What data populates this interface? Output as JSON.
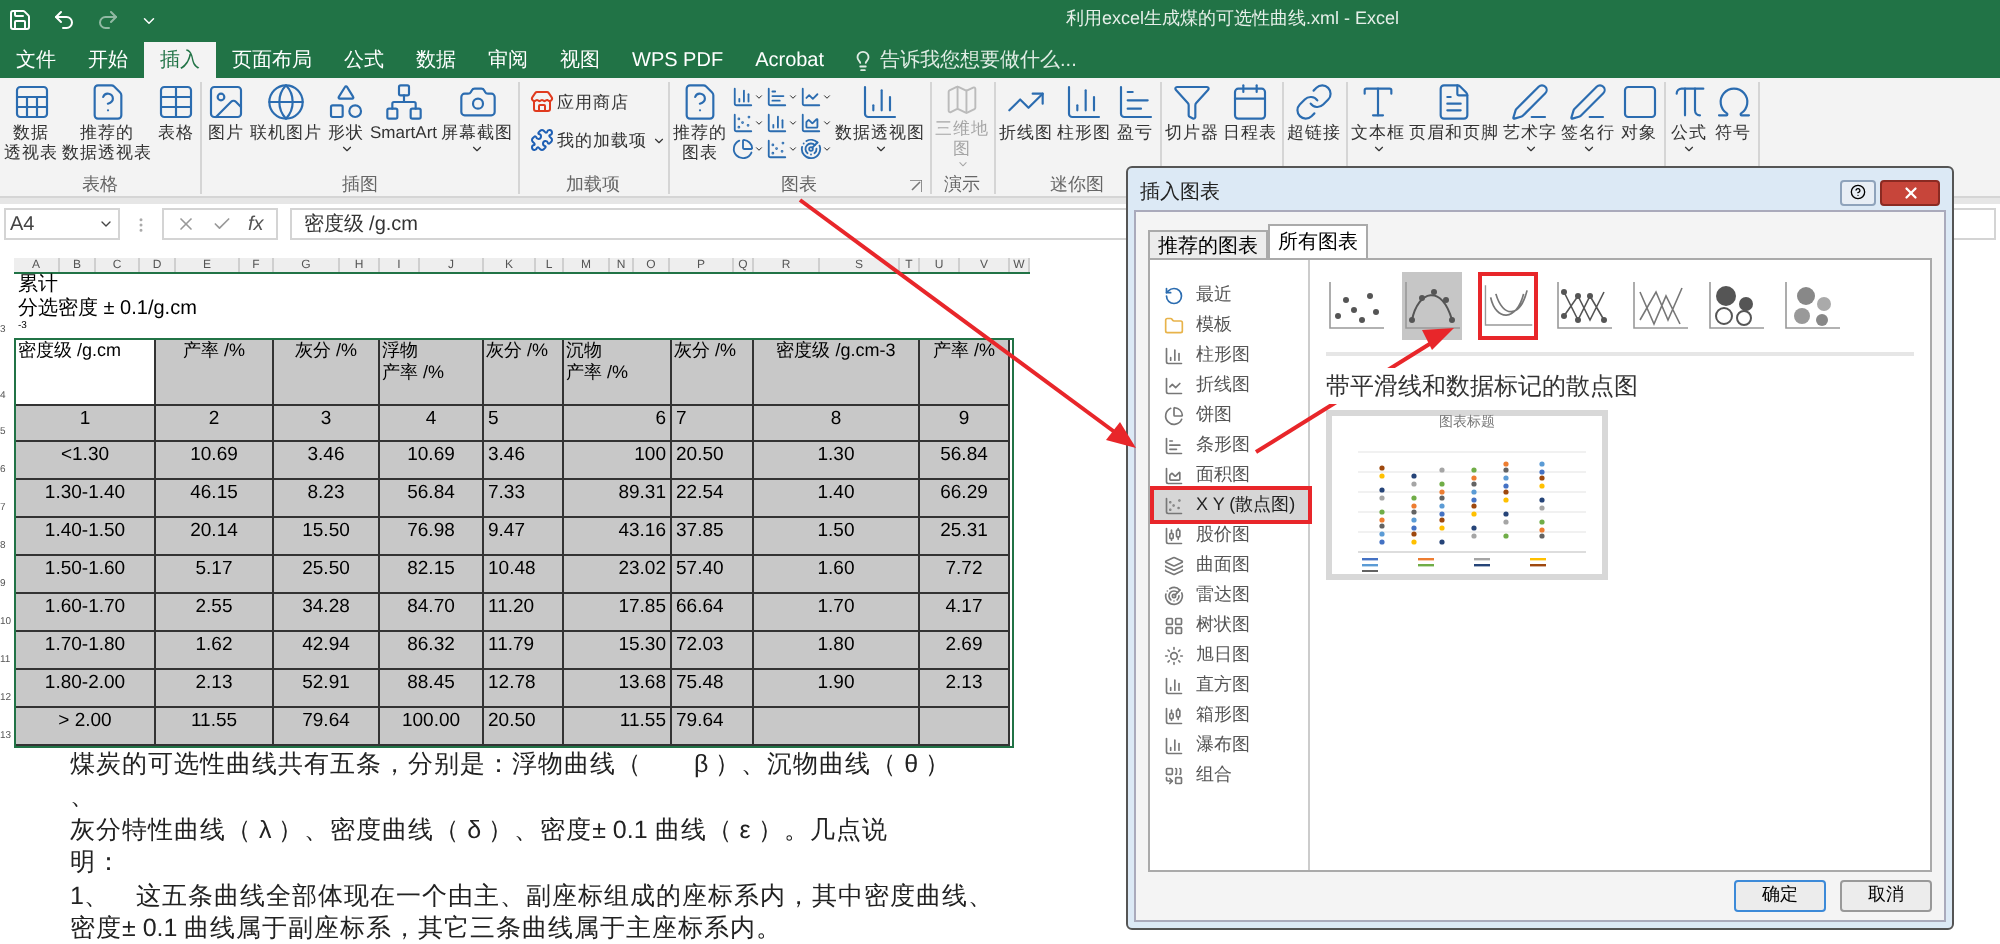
{
  "window": {
    "title": "利用excel生成煤的可选性曲线.xml - Excel"
  },
  "ribbon_tabs": [
    {
      "label": "文件",
      "selected": false
    },
    {
      "label": "开始",
      "selected": false
    },
    {
      "label": "插入",
      "selected": true
    },
    {
      "label": "页面布局",
      "selected": false
    },
    {
      "label": "公式",
      "selected": false
    },
    {
      "label": "数据",
      "selected": false
    },
    {
      "label": "审阅",
      "selected": false
    },
    {
      "label": "视图",
      "selected": false
    },
    {
      "label": "WPS PDF",
      "selected": false
    },
    {
      "label": "Acrobat",
      "selected": false
    }
  ],
  "tell_me": {
    "placeholder": "告诉我您想要做什么..."
  },
  "ribbon_groups": [
    {
      "label": "表格",
      "kind": "large",
      "buttons": [
        {
          "label": [
            "数据",
            "透视表"
          ],
          "dropdown": false,
          "disabled": false
        },
        {
          "label": [
            "推荐的",
            "数据透视表"
          ],
          "dropdown": false,
          "disabled": false
        },
        {
          "label": [
            "表格"
          ],
          "dropdown": false,
          "disabled": false
        }
      ]
    },
    {
      "label": "插图",
      "kind": "large",
      "buttons": [
        {
          "label": [
            "图片"
          ],
          "dropdown": false,
          "disabled": false
        },
        {
          "label": [
            "联机图片"
          ],
          "dropdown": false,
          "disabled": false
        },
        {
          "label": [
            "形状"
          ],
          "dropdown": true,
          "disabled": false
        },
        {
          "label": [
            "SmartArt"
          ],
          "dropdown": false,
          "disabled": false
        },
        {
          "label": [
            "屏幕截图"
          ],
          "dropdown": true,
          "disabled": false
        }
      ]
    },
    {
      "label": "加载项",
      "kind": "small",
      "buttons": [
        {
          "label": [
            "应用商店"
          ],
          "dropdown": false,
          "disabled": false
        },
        {
          "label": [
            "我的加载项"
          ],
          "dropdown": true,
          "disabled": false
        }
      ]
    },
    {
      "label": "图表",
      "kind": "chart",
      "buttons": [
        {
          "label": [
            "推荐的",
            "图表"
          ],
          "dropdown": false,
          "disabled": false
        },
        {
          "label": [
            "数据透视图"
          ],
          "dropdown": true,
          "disabled": false
        }
      ]
    },
    {
      "label": "演示",
      "kind": "large",
      "buttons": [
        {
          "label": [
            "三维地",
            "图"
          ],
          "dropdown": true,
          "disabled": true
        }
      ]
    },
    {
      "label": "迷你图",
      "kind": "large",
      "buttons": [
        {
          "label": [
            "折线图"
          ],
          "dropdown": false,
          "disabled": false
        },
        {
          "label": [
            "柱形图"
          ],
          "dropdown": false,
          "disabled": false
        },
        {
          "label": [
            "盈亏"
          ],
          "dropdown": false,
          "disabled": false
        }
      ]
    },
    {
      "kind": "large",
      "buttons": [
        {
          "label": [
            "切片器"
          ],
          "dropdown": false,
          "disabled": false
        },
        {
          "label": [
            "日程表"
          ],
          "dropdown": false,
          "disabled": false
        }
      ]
    },
    {
      "kind": "large",
      "buttons": [
        {
          "label": [
            "超链接"
          ],
          "dropdown": false,
          "disabled": false
        }
      ]
    },
    {
      "kind": "large",
      "buttons": [
        {
          "label": [
            "文本框"
          ],
          "dropdown": true,
          "disabled": false
        },
        {
          "label": [
            "页眉和页脚"
          ],
          "dropdown": false,
          "disabled": false
        },
        {
          "label": [
            "艺术字"
          ],
          "dropdown": true,
          "disabled": false
        },
        {
          "label": [
            "签名行"
          ],
          "dropdown": true,
          "disabled": false
        },
        {
          "label": [
            "对象"
          ],
          "dropdown": false,
          "disabled": false
        }
      ]
    },
    {
      "kind": "large",
      "buttons": [
        {
          "label": [
            "公式"
          ],
          "dropdown": true,
          "disabled": false
        },
        {
          "label": [
            "符号"
          ],
          "dropdown": false,
          "disabled": false
        }
      ]
    }
  ],
  "formula_bar": {
    "name_box": "A4",
    "fx_label": "fx",
    "formula": "密度级 /g.cm"
  },
  "column_headers": [
    "A",
    "B",
    "C",
    "D",
    "E",
    "F",
    "G",
    "H",
    "I",
    "J",
    "K",
    "L",
    "M",
    "N",
    "O",
    "P",
    "Q",
    "R",
    "S",
    "T",
    "U",
    "V",
    "W"
  ],
  "sheet": {
    "notes": [
      "累计",
      "分选密度 ± 0.1/g.cm",
      "-3"
    ],
    "notes_row": "3",
    "header": {
      "row": "4",
      "cells": [
        {
          "text": [
            "密度级 /g.cm"
          ],
          "selected": true
        },
        {
          "text": [
            "产率 /%"
          ],
          "selected": false
        },
        {
          "text": [
            "灰分 /%"
          ],
          "selected": false
        },
        {
          "text": [
            "浮物",
            "产率 /%"
          ],
          "selected": false
        },
        {
          "text": [
            "灰分 /%"
          ],
          "selected": false
        },
        {
          "text": [
            "沉物",
            "产率 /%"
          ],
          "selected": false
        },
        {
          "text": [
            "灰分 /%"
          ],
          "selected": false
        },
        {
          "text": [
            "密度级 /g.cm-3"
          ],
          "selected": false
        },
        {
          "text": [
            "产率 /%"
          ],
          "selected": false
        }
      ]
    },
    "rows": [
      {
        "row": "5",
        "cells": [
          "1",
          "2",
          "3",
          "4",
          "5",
          "6",
          "7",
          "8",
          "9"
        ]
      },
      {
        "row": "6",
        "cells": [
          "<1.30",
          "10.69",
          "3.46",
          "10.69",
          "3.46",
          "100",
          "20.50",
          "1.30",
          "56.84"
        ]
      },
      {
        "row": "7",
        "cells": [
          "1.30-1.40",
          "46.15",
          "8.23",
          "56.84",
          "7.33",
          "89.31",
          "22.54",
          "1.40",
          "66.29"
        ]
      },
      {
        "row": "8",
        "cells": [
          "1.40-1.50",
          "20.14",
          "15.50",
          "76.98",
          "9.47",
          "43.16",
          "37.85",
          "1.50",
          "25.31"
        ]
      },
      {
        "row": "9",
        "cells": [
          "1.50-1.60",
          "5.17",
          "25.50",
          "82.15",
          "10.48",
          "23.02",
          "57.40",
          "1.60",
          "7.72"
        ]
      },
      {
        "row": "10",
        "cells": [
          "1.60-1.70",
          "2.55",
          "34.28",
          "84.70",
          "11.20",
          "17.85",
          "66.64",
          "1.70",
          "4.17"
        ]
      },
      {
        "row": "11",
        "cells": [
          "1.70-1.80",
          "1.62",
          "42.94",
          "86.32",
          "11.79",
          "15.30",
          "72.03",
          "1.80",
          "2.69"
        ]
      },
      {
        "row": "12",
        "cells": [
          "1.80-2.00",
          "2.13",
          "52.91",
          "88.45",
          "12.78",
          "13.68",
          "75.48",
          "1.90",
          "2.13"
        ]
      },
      {
        "row": "13",
        "cells": [
          "> 2.00",
          "11.55",
          "79.64",
          "100.00",
          "20.50",
          "11.55",
          "79.64"
        ]
      }
    ],
    "paragraph_lines": [
      "煤炭的可选性曲线共有五条，分别是：浮物曲线（　　β ）、沉物曲线（ θ ）",
      "、",
      "灰分特性曲线（ λ ）、密度曲线（ δ ）、密度± 0.1 曲线（ ε ）。几点说",
      "明：",
      "1、　这五条曲线全部体现在一个由主、副座标组成的座标系内，其中密度曲线、",
      "密度± 0.1 曲线属于副座标系，其它三条曲线属于主座标系内。"
    ]
  },
  "dialog": {
    "title": "插入图表",
    "tabs": [
      {
        "label": "推荐的图表",
        "selected": false
      },
      {
        "label": "所有图表",
        "selected": true
      }
    ],
    "categories": [
      {
        "label": "最近",
        "selected": false,
        "highlighted": false
      },
      {
        "label": "模板",
        "selected": false,
        "highlighted": false
      },
      {
        "label": "柱形图",
        "selected": false,
        "highlighted": false
      },
      {
        "label": "折线图",
        "selected": false,
        "highlighted": false
      },
      {
        "label": "饼图",
        "selected": false,
        "highlighted": false
      },
      {
        "label": "条形图",
        "selected": false,
        "highlighted": false
      },
      {
        "label": "面积图",
        "selected": false,
        "highlighted": false
      },
      {
        "label": "X Y (散点图)",
        "selected": true,
        "highlighted": true
      },
      {
        "label": "股价图",
        "selected": false,
        "highlighted": false
      },
      {
        "label": "曲面图",
        "selected": false,
        "highlighted": false
      },
      {
        "label": "雷达图",
        "selected": false,
        "highlighted": false
      },
      {
        "label": "树状图",
        "selected": false,
        "highlighted": false
      },
      {
        "label": "旭日图",
        "selected": false,
        "highlighted": false
      },
      {
        "label": "直方图",
        "selected": false,
        "highlighted": false
      },
      {
        "label": "箱形图",
        "selected": false,
        "highlighted": false
      },
      {
        "label": "瀑布图",
        "selected": false,
        "highlighted": false
      },
      {
        "label": "组合",
        "selected": false,
        "highlighted": false
      }
    ],
    "subtypes": [
      {
        "selected": false,
        "highlighted": false
      },
      {
        "selected": true,
        "highlighted": false
      },
      {
        "selected": false,
        "highlighted": true
      },
      {
        "selected": false,
        "highlighted": false
      },
      {
        "selected": false,
        "highlighted": false
      },
      {
        "selected": false,
        "highlighted": false
      },
      {
        "selected": false,
        "highlighted": false
      }
    ],
    "subtype_title": "带平滑线和数据标记的散点图",
    "preview_title": "图表标题",
    "buttons": [
      {
        "label": "确定",
        "default": true
      },
      {
        "label": "取消",
        "default": false
      }
    ]
  }
}
